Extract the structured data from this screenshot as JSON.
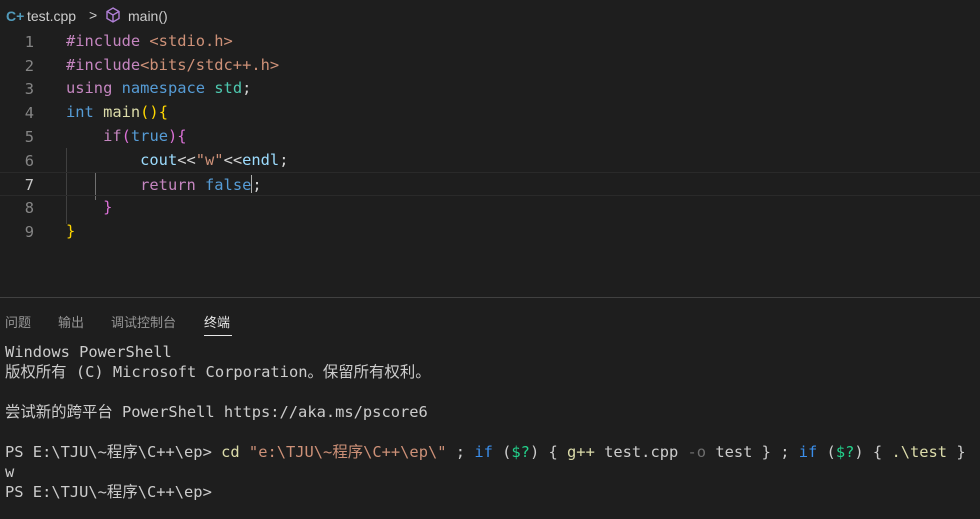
{
  "breadcrumb": {
    "file": "test.cpp",
    "separator": ">",
    "symbol": "main()"
  },
  "editor": {
    "lines": [
      {
        "num": "1",
        "tokens": [
          [
            "k-pre",
            "#include "
          ],
          [
            "k-str",
            "<stdio.h>"
          ]
        ]
      },
      {
        "num": "2",
        "tokens": [
          [
            "k-pre",
            "#include"
          ],
          [
            "k-str",
            "<bits/stdc++.h>"
          ]
        ]
      },
      {
        "num": "3",
        "tokens": [
          [
            "k-ctrl",
            "using "
          ],
          [
            "k-blue",
            "namespace "
          ],
          [
            "k-ns",
            "std"
          ],
          [
            "k-plain",
            ";"
          ]
        ]
      },
      {
        "num": "4",
        "tokens": [
          [
            "k-blue",
            "int "
          ],
          [
            "k-fn",
            "main"
          ],
          [
            "k-br1",
            "()"
          ],
          [
            "k-br1",
            "{"
          ]
        ]
      },
      {
        "num": "5",
        "tokens": [
          [
            "k-plain",
            "    "
          ],
          [
            "k-ctrl",
            "if"
          ],
          [
            "k-br2",
            "("
          ],
          [
            "k-blue",
            "true"
          ],
          [
            "k-br2",
            ")"
          ],
          [
            "k-br2",
            "{"
          ]
        ]
      },
      {
        "num": "6",
        "tokens": [
          [
            "k-plain",
            "        "
          ],
          [
            "k-var",
            "cout"
          ],
          [
            "k-plain",
            "<<"
          ],
          [
            "k-str",
            "\"w\""
          ],
          [
            "k-plain",
            "<<"
          ],
          [
            "k-var",
            "endl"
          ],
          [
            "k-plain",
            ";"
          ]
        ]
      },
      {
        "num": "7",
        "tokens": [
          [
            "k-plain",
            "        "
          ],
          [
            "k-ctrl",
            "return "
          ],
          [
            "k-blue",
            "false"
          ],
          [
            "cursor",
            ""
          ],
          [
            "k-plain",
            ";"
          ]
        ]
      },
      {
        "num": "8",
        "tokens": [
          [
            "k-plain",
            "    "
          ],
          [
            "k-br2",
            "}"
          ]
        ]
      },
      {
        "num": "9",
        "tokens": [
          [
            "k-br1",
            "}"
          ]
        ]
      }
    ],
    "active_line": 7
  },
  "panel": {
    "tabs": [
      {
        "label": "问题",
        "active": false
      },
      {
        "label": "输出",
        "active": false
      },
      {
        "label": "调试控制台",
        "active": false
      },
      {
        "label": "终端",
        "active": true
      }
    ]
  },
  "terminal": {
    "lines": [
      [
        [
          "",
          "Windows PowerShell"
        ]
      ],
      [
        [
          "",
          "版权所有 (C) Microsoft Corporation。保留所有权利。"
        ]
      ],
      [
        [
          "",
          ""
        ]
      ],
      [
        [
          "",
          "尝试新的跨平台 PowerShell https://aka.ms/pscore6"
        ]
      ],
      [
        [
          "",
          ""
        ]
      ],
      [
        [
          "",
          "PS E:\\TJU\\~程序\\C++\\ep> "
        ],
        [
          "t-cmd",
          "cd "
        ],
        [
          "t-str",
          "\"e:\\TJU\\~程序\\C++\\ep\\\""
        ],
        [
          "",
          " ; "
        ],
        [
          "t-kw",
          "if"
        ],
        [
          "",
          " ("
        ],
        [
          "t-var",
          "$?"
        ],
        [
          "",
          ") { "
        ],
        [
          "t-cmd",
          "g++"
        ],
        [
          "",
          " test.cpp "
        ],
        [
          "t-param",
          "-o"
        ],
        [
          "",
          " test } ; "
        ],
        [
          "t-kw",
          "if"
        ],
        [
          "",
          " ("
        ],
        [
          "t-var",
          "$?"
        ],
        [
          "",
          ") { "
        ],
        [
          "t-cmd",
          ".\\test"
        ],
        [
          "",
          " }"
        ]
      ],
      [
        [
          "",
          "w"
        ]
      ],
      [
        [
          "",
          "PS E:\\TJU\\~程序\\C++\\ep>"
        ]
      ]
    ]
  },
  "colors": {
    "background": "#1e1e1e",
    "accent_file_icon": "#519aba",
    "symbol_icon": "#b180d7"
  }
}
